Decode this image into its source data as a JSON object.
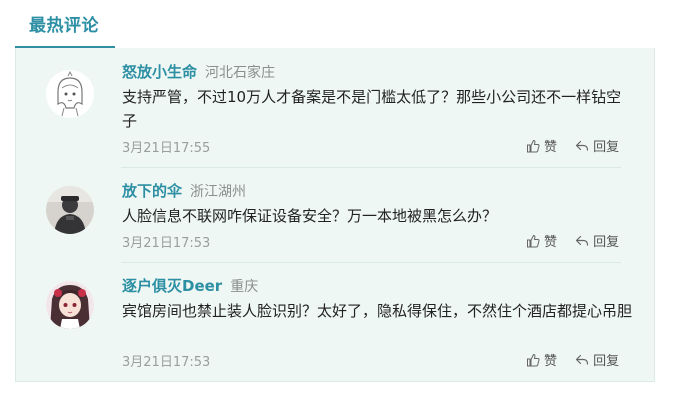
{
  "section": {
    "title": "最热评论"
  },
  "comments": [
    {
      "user": "怒放小生命",
      "location": "河北石家庄",
      "text": "支持严管，不过10万人才备案是不是门槛太低了？那些小公司还不一样钻空子",
      "time": "3月21日17:55",
      "like_label": "赞",
      "reply_label": "回复"
    },
    {
      "user": "放下的伞",
      "location": "浙江湖州",
      "text": "人脸信息不联网咋保证设备安全？万一本地被黑怎么办？",
      "time": "3月21日17:53",
      "like_label": "赞",
      "reply_label": "回复"
    },
    {
      "user": "逐户俱灭Deer",
      "location": "重庆",
      "text": "宾馆房间也禁止装人脸识别？太好了，隐私得保住，不然住个酒店都提心吊胆",
      "time": "3月21日17:53",
      "like_label": "赞",
      "reply_label": "回复"
    }
  ]
}
